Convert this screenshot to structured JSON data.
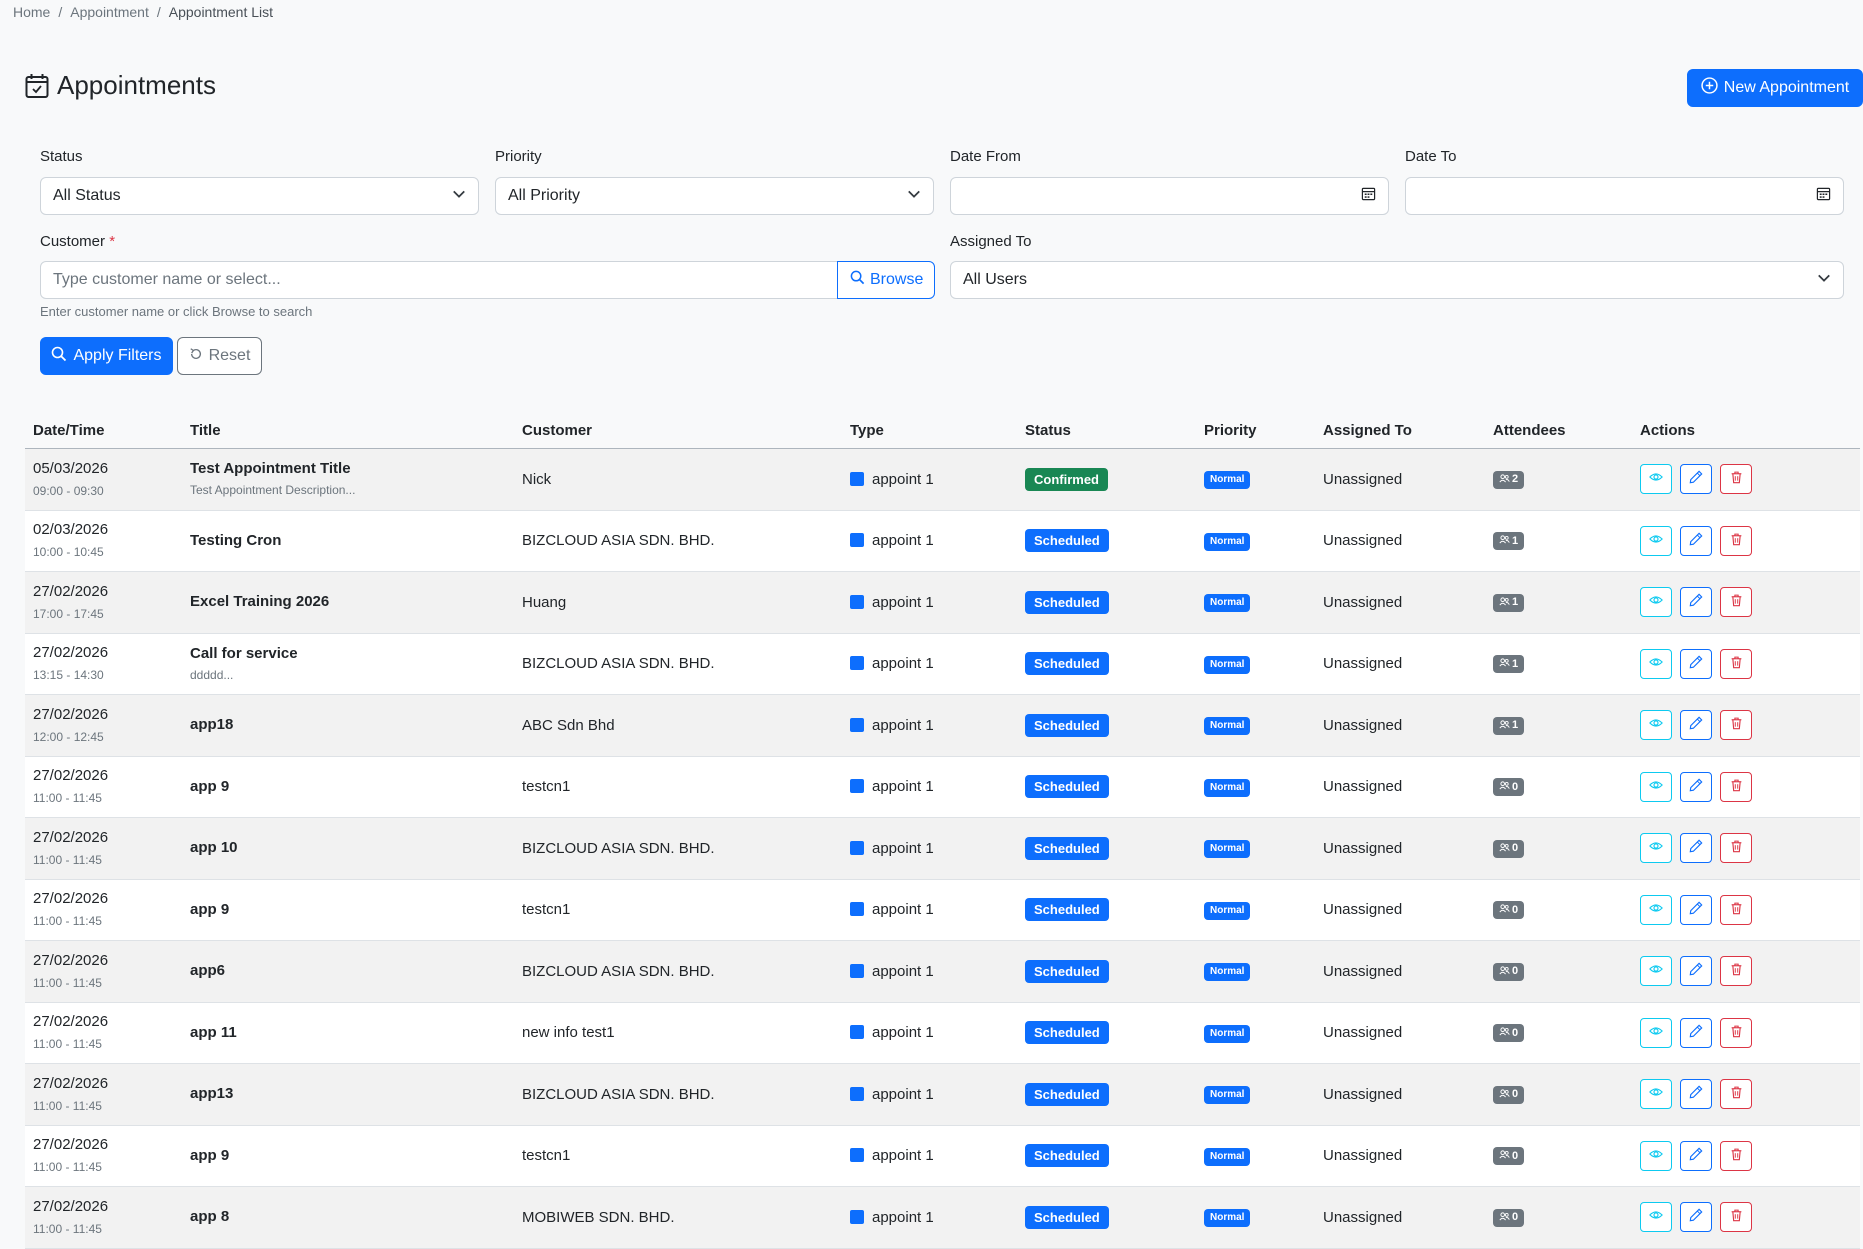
{
  "breadcrumb": {
    "home": "Home",
    "section": "Appointment",
    "current": "Appointment List"
  },
  "page": {
    "title": "Appointments",
    "new_button": "New Appointment"
  },
  "filters": {
    "status_label": "Status",
    "status_value": "All Status",
    "priority_label": "Priority",
    "priority_value": "All Priority",
    "date_from_label": "Date From",
    "date_to_label": "Date To",
    "customer_label": "Customer",
    "customer_required": "*",
    "customer_placeholder": "Type customer name or select...",
    "browse_label": "Browse",
    "customer_help": "Enter customer name or click Browse to search",
    "assigned_label": "Assigned To",
    "assigned_value": "All Users",
    "apply_label": "Apply Filters",
    "reset_label": "Reset"
  },
  "table": {
    "headers": [
      "Date/Time",
      "Title",
      "Customer",
      "Type",
      "Status",
      "Priority",
      "Assigned To",
      "Attendees",
      "Actions"
    ],
    "rows": [
      {
        "date": "05/03/2026",
        "time": "09:00 - 09:30",
        "title": "Test Appointment Title",
        "desc": "Test Appointment Description...",
        "customer": "Nick",
        "type": "appoint 1",
        "status": "Confirmed",
        "priority": "Normal",
        "assigned": "Unassigned",
        "attendees": "2"
      },
      {
        "date": "02/03/2026",
        "time": "10:00 - 10:45",
        "title": "Testing Cron",
        "desc": "",
        "customer": "BIZCLOUD ASIA SDN. BHD.",
        "type": "appoint 1",
        "status": "Scheduled",
        "priority": "Normal",
        "assigned": "Unassigned",
        "attendees": "1"
      },
      {
        "date": "27/02/2026",
        "time": "17:00 - 17:45",
        "title": "Excel Training 2026",
        "desc": "",
        "customer": "Huang",
        "type": "appoint 1",
        "status": "Scheduled",
        "priority": "Normal",
        "assigned": "Unassigned",
        "attendees": "1"
      },
      {
        "date": "27/02/2026",
        "time": "13:15 - 14:30",
        "title": "Call for service",
        "desc": "ddddd...",
        "customer": "BIZCLOUD ASIA SDN. BHD.",
        "type": "appoint 1",
        "status": "Scheduled",
        "priority": "Normal",
        "assigned": "Unassigned",
        "attendees": "1"
      },
      {
        "date": "27/02/2026",
        "time": "12:00 - 12:45",
        "title": "app18",
        "desc": "",
        "customer": "ABC Sdn Bhd",
        "type": "appoint 1",
        "status": "Scheduled",
        "priority": "Normal",
        "assigned": "Unassigned",
        "attendees": "1"
      },
      {
        "date": "27/02/2026",
        "time": "11:00 - 11:45",
        "title": "app 9",
        "desc": "",
        "customer": "testcn1",
        "type": "appoint 1",
        "status": "Scheduled",
        "priority": "Normal",
        "assigned": "Unassigned",
        "attendees": "0"
      },
      {
        "date": "27/02/2026",
        "time": "11:00 - 11:45",
        "title": "app 10",
        "desc": "",
        "customer": "BIZCLOUD ASIA SDN. BHD.",
        "type": "appoint 1",
        "status": "Scheduled",
        "priority": "Normal",
        "assigned": "Unassigned",
        "attendees": "0"
      },
      {
        "date": "27/02/2026",
        "time": "11:00 - 11:45",
        "title": "app 9",
        "desc": "",
        "customer": "testcn1",
        "type": "appoint 1",
        "status": "Scheduled",
        "priority": "Normal",
        "assigned": "Unassigned",
        "attendees": "0"
      },
      {
        "date": "27/02/2026",
        "time": "11:00 - 11:45",
        "title": "app6",
        "desc": "",
        "customer": "BIZCLOUD ASIA SDN. BHD.",
        "type": "appoint 1",
        "status": "Scheduled",
        "priority": "Normal",
        "assigned": "Unassigned",
        "attendees": "0"
      },
      {
        "date": "27/02/2026",
        "time": "11:00 - 11:45",
        "title": "app 11",
        "desc": "",
        "customer": "new info test1",
        "type": "appoint 1",
        "status": "Scheduled",
        "priority": "Normal",
        "assigned": "Unassigned",
        "attendees": "0"
      },
      {
        "date": "27/02/2026",
        "time": "11:00 - 11:45",
        "title": "app13",
        "desc": "",
        "customer": "BIZCLOUD ASIA SDN. BHD.",
        "type": "appoint 1",
        "status": "Scheduled",
        "priority": "Normal",
        "assigned": "Unassigned",
        "attendees": "0"
      },
      {
        "date": "27/02/2026",
        "time": "11:00 - 11:45",
        "title": "app 9",
        "desc": "",
        "customer": "testcn1",
        "type": "appoint 1",
        "status": "Scheduled",
        "priority": "Normal",
        "assigned": "Unassigned",
        "attendees": "0"
      },
      {
        "date": "27/02/2026",
        "time": "11:00 - 11:45",
        "title": "app 8",
        "desc": "",
        "customer": "MOBIWEB SDN. BHD.",
        "type": "appoint 1",
        "status": "Scheduled",
        "priority": "Normal",
        "assigned": "Unassigned",
        "attendees": "0"
      }
    ]
  },
  "colors": {
    "primary": "#0d6efd",
    "success": "#198754",
    "info": "#0dcaf0",
    "danger": "#dc3545",
    "secondary": "#6c757d"
  },
  "icons": {
    "title": "calendar-check-icon",
    "new": "plus-circle-icon",
    "browse": "search-icon",
    "apply": "search-icon",
    "reset": "reset-icon",
    "date": "calendar-icon",
    "dropdown": "chevron-down-icon",
    "attendees": "people-icon",
    "view": "eye-icon",
    "edit": "pencil-icon",
    "delete": "trash-icon"
  }
}
